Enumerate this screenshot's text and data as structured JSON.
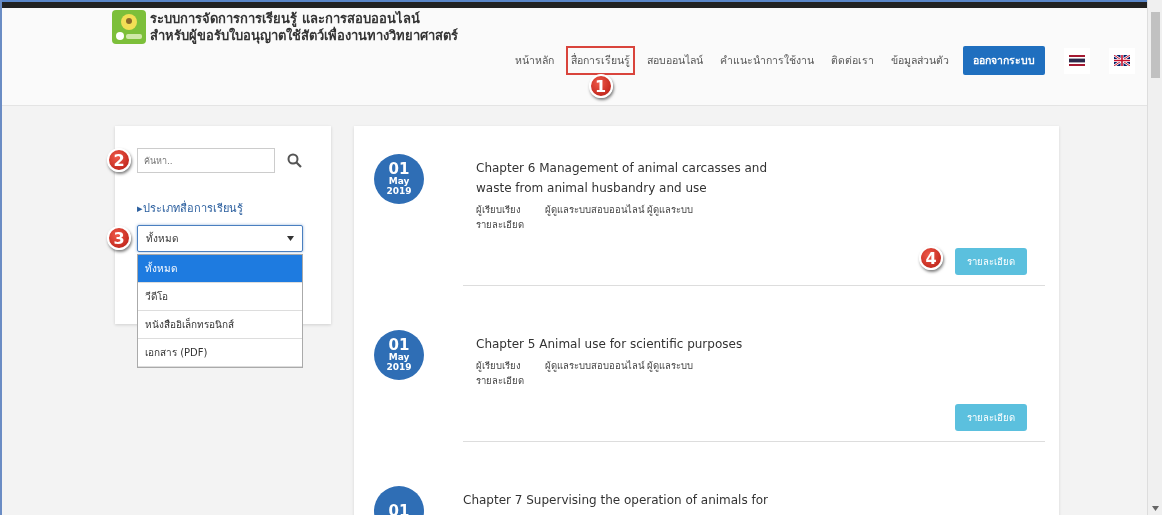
{
  "header": {
    "title_lines": [
      "ระบบการจัดการการเรียนรู้ และการสอบออนไลน์",
      "สำหรับผู้ขอรับใบอนุญาตใช้สัตว์เพื่องานทางวิทยาศาสตร์"
    ],
    "nav": [
      {
        "label": "หน้าหลัก",
        "highlighted": false
      },
      {
        "label": "สื่อการเรียนรู้",
        "highlighted": true,
        "callout": "1"
      },
      {
        "label": "สอบออนไลน์",
        "highlighted": false
      },
      {
        "label": "คำแนะนำการใช้งาน",
        "highlighted": false
      },
      {
        "label": "ติดต่อเรา",
        "highlighted": false
      },
      {
        "label": "ข้อมูลส่วนตัว",
        "highlighted": false
      }
    ],
    "logout": "ออกจากระบบ"
  },
  "sidebar": {
    "search": {
      "placeholder": "ค้นหา..",
      "callout": "2"
    },
    "category_marker": "▸",
    "category_label": "ประเภทสื่อการเรียนรู้",
    "select": {
      "value": "ทั้งหมด",
      "expanded": true,
      "callout": "3",
      "options": [
        {
          "label": "ทั้งหมด",
          "selected": true
        },
        {
          "label": "วีดีโอ",
          "selected": false
        },
        {
          "label": "หนังสืออิเล็กทรอนิกส์",
          "selected": false
        },
        {
          "label": "เอกสาร (PDF)",
          "selected": false
        }
      ]
    }
  },
  "items": [
    {
      "day": "01",
      "month": "May",
      "year": "2019",
      "title": "Chapter 6 Management of animal carcasses and waste from animal husbandry and use",
      "author": "ผู้เรียบเรียง",
      "author_value": "ผู้ดูแลระบบสอบออนไลน์ ผู้ดูแลระบบ",
      "detail_label": "รายละเอียด",
      "button": "รายละเอียด",
      "callout": "4"
    },
    {
      "day": "01",
      "month": "May",
      "year": "2019",
      "title": "Chapter 5 Animal use for scientific purposes",
      "author": "ผู้เรียบเรียง",
      "author_value": "ผู้ดูแลระบบสอบออนไลน์ ผู้ดูแลระบบ",
      "detail_label": "รายละเอียด",
      "button": "รายละเอียด"
    },
    {
      "day": "01",
      "title": "Chapter 7 Supervising the operation of animals for"
    }
  ]
}
